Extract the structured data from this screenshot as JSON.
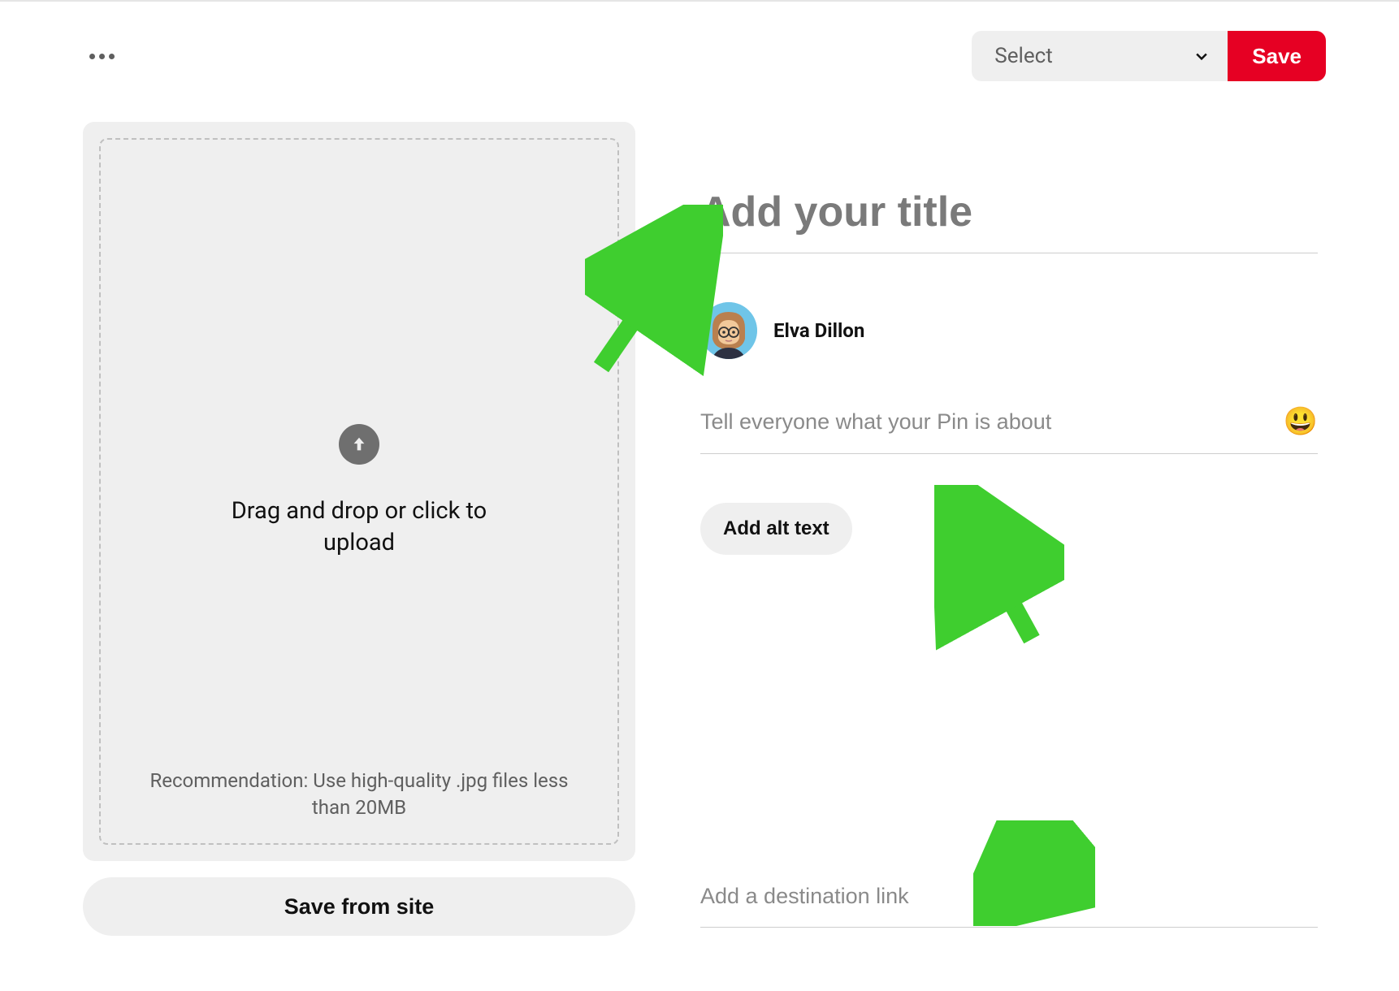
{
  "header": {
    "board_select_label": "Select",
    "save_label": "Save"
  },
  "upload": {
    "main_text": "Drag and drop or click to upload",
    "recommendation": "Recommendation: Use high-quality .jpg files less than 20MB",
    "save_from_site_label": "Save from site"
  },
  "form": {
    "title_placeholder": "Add your title",
    "description_placeholder": "Tell everyone what your Pin is about",
    "alt_text_label": "Add alt text",
    "link_placeholder": "Add a destination link"
  },
  "user": {
    "name": "Elva Dillon"
  }
}
